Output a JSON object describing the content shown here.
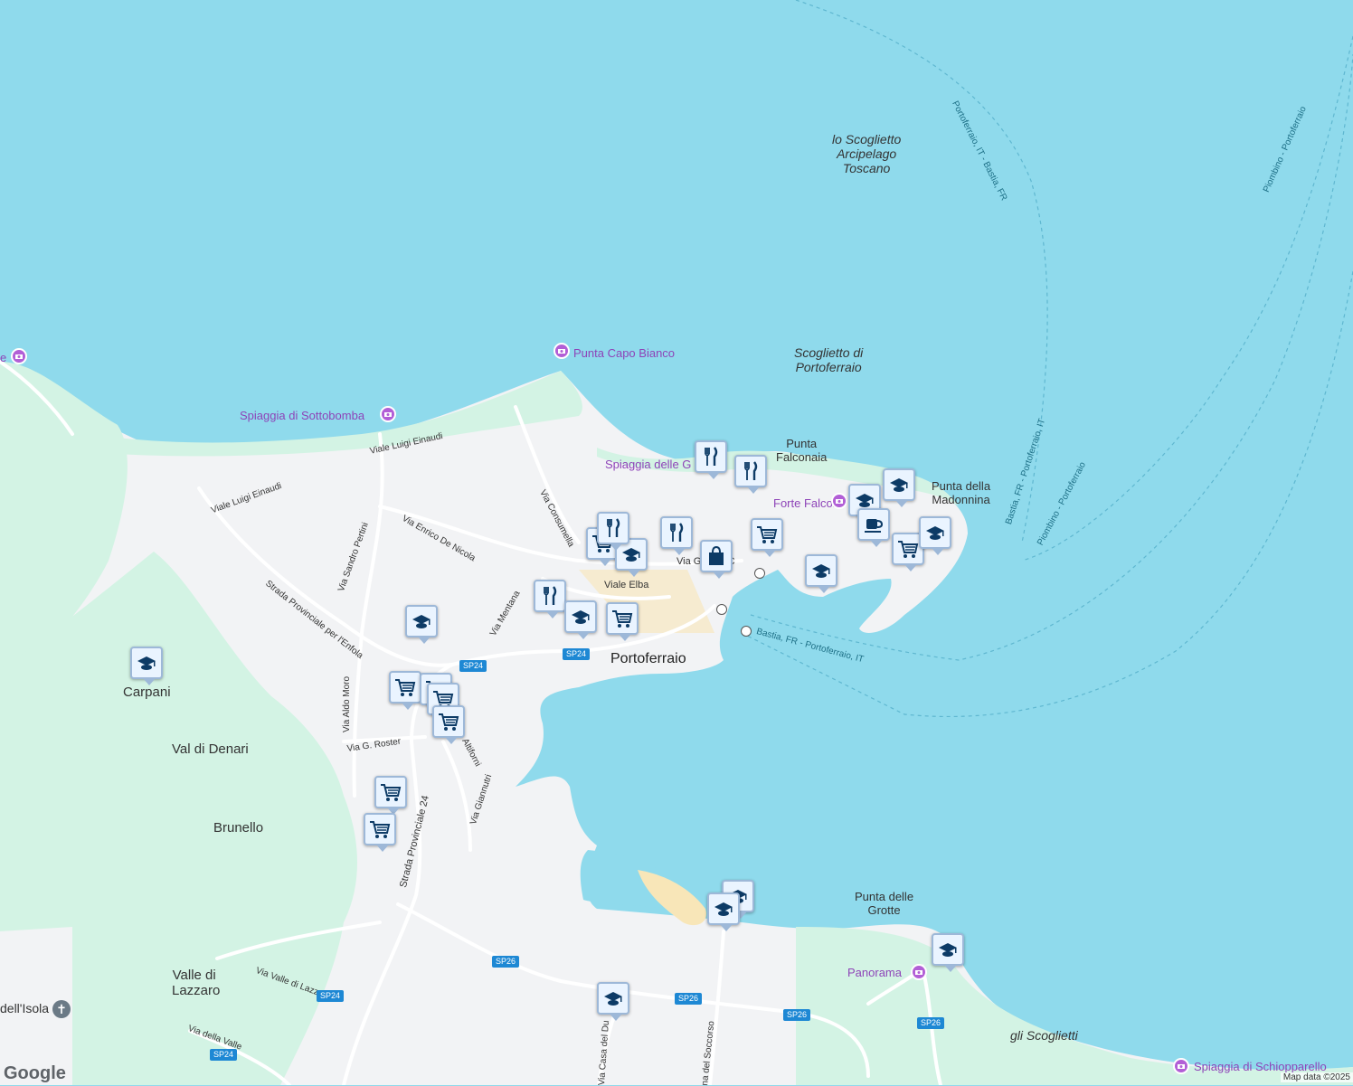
{
  "map": {
    "water_color": "#8fdaec",
    "land_color": "#f2f3f5",
    "green_color": "#d3f3e4",
    "beach_color": "#f8e6b8"
  },
  "places": {
    "carpani": "Carpani",
    "val_di_denari": "Val di Denari",
    "brunello": "Brunello",
    "valle_di_lazzaro_1": "Valle di",
    "valle_di_lazzaro_2": "Lazzaro",
    "portoferraio": "Portoferraio",
    "dell_isola": "dell'Isola",
    "punta_falconaia_1": "Punta",
    "punta_falconaia_2": "Falconaia",
    "punta_madonnina_1": "Punta della",
    "punta_madonnina_2": "Madonnina",
    "punta_grotte_1": "Punta delle",
    "punta_grotte_2": "Grotte"
  },
  "water": {
    "scoglietto_1": "lo Scoglietto",
    "scoglietto_2": "Arcipelago",
    "scoglietto_3": "Toscano",
    "scoglietto_portoferraio_1": "Scoglietto di",
    "scoglietto_portoferraio_2": "Portoferraio",
    "gli_scoglietti": "gli Scoglietti"
  },
  "pois": {
    "punta_capo_bianco": "Punta Capo Bianco",
    "spiaggia_sottobomba": "Spiaggia di Sottobomba",
    "spiaggia_delle_ghiaie": "Spiaggia delle G",
    "forte_falcone": "Forte Falcone",
    "panorama": "Panorama",
    "spiaggia_schiopparello": "Spiaggia di Schiopparello",
    "edge_poi": "e"
  },
  "ferry_routes": {
    "portoferraio_bastia_top": "Portoferraio, IT - Bastia, FR",
    "piombino_portoferraio_top": "Piombino - Portoferraio",
    "bastia_portoferraio_mid": "Bastia, FR - Portoferraio, IT",
    "piombino_portoferraio_mid": "Piombino - Portoferraio",
    "bastia_portoferraio_harbor": "Bastia, FR - Portoferraio, IT"
  },
  "roads": {
    "viale_luigi_einaudi_1": "Viale Luigi Einaudi",
    "viale_luigi_einaudi_2": "Viale Luigi Einaudi",
    "via_sandro_pertini": "Via Sandro Pertini",
    "via_enrico_de_nicola": "Via Enrico De Nicola",
    "via_consumella": "Via Consumella",
    "strada_enfola": "Strada Provinciale per l'Enfola",
    "via_mentana": "Via Mentana",
    "viale_elba": "Viale Elba",
    "via_giosue": "Via Giosuè C",
    "via_aldo_moro": "Via Aldo Moro",
    "via_roster": "Via G. Roster",
    "via_altiforni": "Altiforni",
    "via_giannutri": "Via Giannutri",
    "strada_provinciale_24": "Strada Provinciale 24",
    "via_valle_di_lazzaro": "Via Valle di Lazzaro",
    "via_della_valle": "Via della Valle",
    "via_casa_del_duca": "Via Casa del Du",
    "via_madonna_soccorso": "na del Soccorso"
  },
  "shields": {
    "sp24_a": "SP24",
    "sp24_b": "SP24",
    "sp24_c": "SP24",
    "sp24_d": "SP24",
    "sp26_a": "SP26",
    "sp26_b": "SP26",
    "sp26_c": "SP26",
    "sp26_d": "SP26"
  },
  "markers": [
    {
      "type": "school-icon"
    },
    {
      "type": "school-icon"
    },
    {
      "type": "cart-icon"
    },
    {
      "type": "cart-icon"
    },
    {
      "type": "cart-icon"
    },
    {
      "type": "cart-icon"
    },
    {
      "type": "cart-icon"
    },
    {
      "type": "cart-icon"
    },
    {
      "type": "restaurant-icon"
    },
    {
      "type": "school-icon"
    },
    {
      "type": "cart-icon"
    },
    {
      "type": "cart-icon"
    },
    {
      "type": "school-icon"
    },
    {
      "type": "restaurant-icon"
    },
    {
      "type": "restaurant-icon"
    },
    {
      "type": "restaurant-icon"
    },
    {
      "type": "restaurant-icon"
    },
    {
      "type": "shopping-bag-icon"
    },
    {
      "type": "cart-icon"
    },
    {
      "type": "school-icon"
    },
    {
      "type": "school-icon"
    },
    {
      "type": "coffee-icon"
    },
    {
      "type": "cart-icon"
    },
    {
      "type": "school-icon"
    },
    {
      "type": "school-icon"
    },
    {
      "type": "school-icon"
    },
    {
      "type": "school-icon"
    },
    {
      "type": "school-icon"
    },
    {
      "type": "school-icon"
    }
  ],
  "attribution": "Map data ©2025",
  "logo": "Google"
}
